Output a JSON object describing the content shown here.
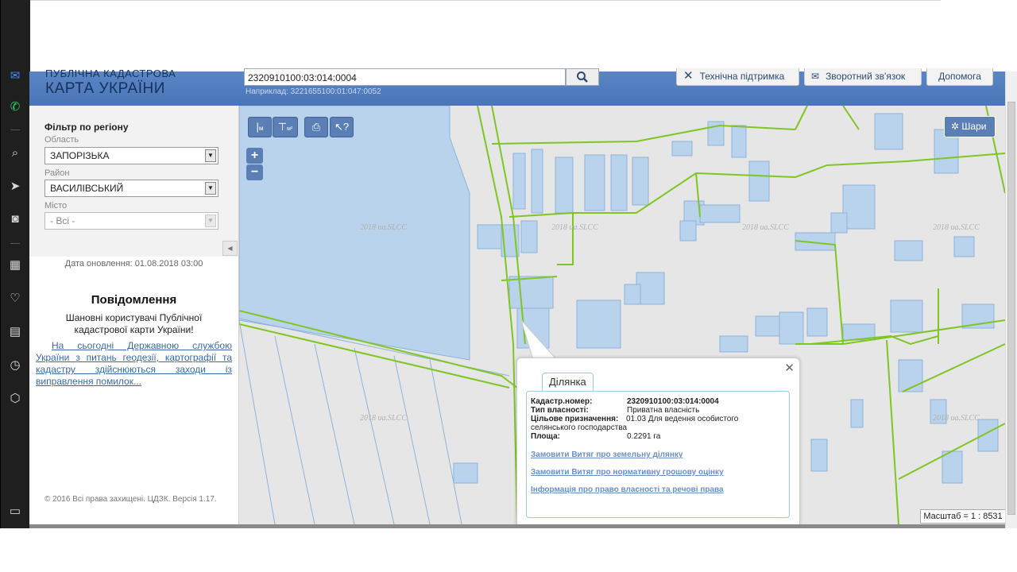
{
  "logo": {
    "line1": "ПУБЛІЧНА КАДАСТРОВА",
    "line2": "КАРТА УКРАЇНИ"
  },
  "search": {
    "value": "2320910100:03:014:0004",
    "hint": "Наприклад: 3221655100:01:047:0052"
  },
  "header_buttons": {
    "support": "Технічна підтримка",
    "feedback": "Зворотний зв'язок",
    "help": "Допомога"
  },
  "filter": {
    "title": "Фільтр по регіону",
    "oblast_label": "Область",
    "oblast_value": "ЗАПОРІЗЬКА",
    "raion_label": "Район",
    "raion_value": "ВАСИЛІВСЬКИЙ",
    "misto_label": "Місто",
    "misto_value": "- Всі -"
  },
  "news": {
    "updated": "Дата оновлення: 01.08.2018 03:00",
    "title": "Повідомлення",
    "greeting": "Шановні користувачі Публічної кадастрової карти України!",
    "link": "На сьогодні Державною службою України з питань геодезії, картографії та кадастру здійснюються заходи із виправлення помилок...",
    "copyright": "© 2016 Всі права захищені. ЦДЗК. Версія 1.17."
  },
  "map": {
    "layers_label": "Шари",
    "scale": "Масштаб = 1 : 8531",
    "watermark": "2018 ua.SLCC",
    "tools": {
      "measure_line": "м",
      "measure_area": "м²"
    },
    "zoom_in": "+",
    "zoom_out": "−"
  },
  "parcel": {
    "tab": "Ділянка",
    "cadastral_label": "Кадастр.номер:",
    "cadastral_value": "2320910100:03:014:0004",
    "ownership_label": "Тип власності:",
    "ownership_value": "Приватна власність",
    "purpose_label": "Цільове призначення:",
    "purpose_value": "01.03 Для ведення особистого селянського господарства",
    "area_label": "Площа:",
    "area_value": "0.2291 га",
    "link1": "Замовити Витяг про земельну ділянку",
    "link2": "Замовити Витяг про нормативну грошову оцінку",
    "link3": "Інформація про право власності та речові права"
  },
  "colors": {
    "header": "#4a76b8",
    "boundary": "#7fc623",
    "building": "#b9d3ec",
    "map_bg": "#e6e6e6"
  },
  "icons": [
    "messenger-icon",
    "whatsapp-icon",
    "search-icon",
    "send-icon",
    "camera-icon",
    "apps-icon",
    "heart-icon",
    "news-icon",
    "history-icon",
    "box-icon",
    "sidebar-toggle-icon"
  ]
}
